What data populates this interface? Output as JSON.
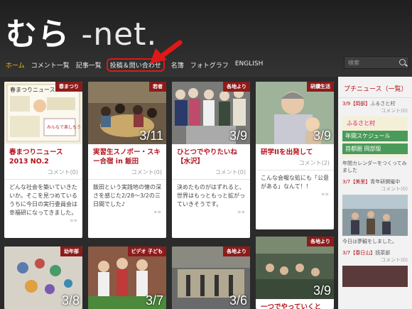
{
  "site": {
    "logo_main": "むら",
    "logo_suffix": "-net."
  },
  "nav": {
    "items": [
      "ホーム",
      "コメント一覧",
      "記事一覧",
      "投稿＆問い合わせ",
      "名簿",
      "フォトグラフ",
      "ENGLISH"
    ]
  },
  "search": {
    "placeholder": "検索"
  },
  "cards": [
    {
      "badge": "春まつり",
      "title": "春まつりニュース 2013 NO.2",
      "comment": "コメント(0)",
      "body": "どんな社会を築いていきたいか。そこを見つめているうちに今日の実行委員会は幸福研になってきました。",
      "more": "»»",
      "num": ""
    },
    {
      "badge": "若者",
      "title": "実習生スノボー・スキー合宿 in 飯田",
      "comment": "コメント(0)",
      "body": "飯田という実践地の懐の深さを感じた2/28〜3/2の三日間でした♪",
      "more": "»»",
      "num": "3/11"
    },
    {
      "badge": "各地より",
      "title": "ひとつでやりたいね【水沢】",
      "comment": "コメント(0)",
      "body": "決めたものがはずれると、世界はもっともっと拡がっていきそうです。",
      "more": "»»",
      "num": "3/9"
    },
    {
      "badge": "研鑽生活",
      "title": "研学IIを出発して",
      "comment": "コメント(2)",
      "body": "こんな会報な処にも「公意がある」なんて！！",
      "more": "»»",
      "num": "3/9"
    },
    {
      "badge": "幼年部",
      "num": "3/8"
    },
    {
      "badge": "ビデオ 子ども",
      "num": "3/7"
    },
    {
      "badge": "各地より",
      "num": "3/6"
    },
    {
      "badge": "各地より",
      "num": "3/9",
      "title": "一つでやっていくと"
    }
  ],
  "sidebar": {
    "title": "プチニュース（一覧）",
    "items": [
      {
        "date": "3/9【岡部】",
        "text": "ふるさと村",
        "comment": "コメント(0)",
        "img_text": [
          "ふるさと村",
          "年間スケジュール",
          "首都圏 岡部版"
        ],
        "caption": "年間カレンダーをつくってみました"
      },
      {
        "date": "3/7【美里】",
        "text": "青年研開催中",
        "comment": "コメント(0)",
        "caption": "今日は夢観をしました。"
      },
      {
        "date": "3/7【春日山】",
        "text": "読菜部",
        "comment": "コメント(0)"
      }
    ]
  },
  "thumb1_text": [
    "春まつりニュース",
    "みんなで楽しもう"
  ]
}
